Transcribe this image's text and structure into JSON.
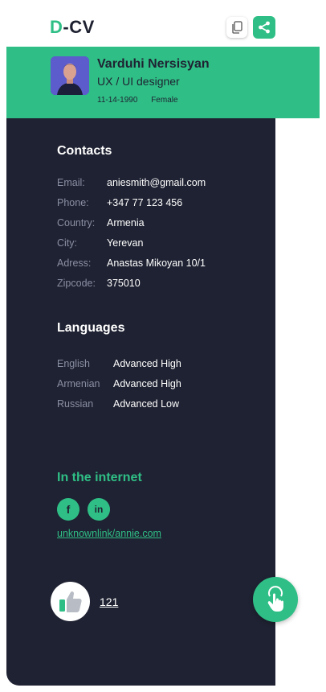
{
  "logo": {
    "prefix": "D",
    "rest": "-CV"
  },
  "toolbar": {
    "copy_icon": "copy-icon",
    "share_icon": "share-icon"
  },
  "profile": {
    "name": "Varduhi Nersisyan",
    "role": "UX / UI designer",
    "birthdate": "11-14-1990",
    "gender": "Female"
  },
  "contacts": {
    "title": "Contacts",
    "items": [
      {
        "label": "Email:",
        "value": "aniesmith@gmail.com"
      },
      {
        "label": "Phone:",
        "value": "+347 77 123 456"
      },
      {
        "label": "Country:",
        "value": "Armenia"
      },
      {
        "label": "City:",
        "value": "Yerevan"
      },
      {
        "label": "Adress:",
        "value": "Anastas Mikoyan 10/1"
      },
      {
        "label": "Zipcode:",
        "value": "375010"
      }
    ]
  },
  "languages": {
    "title": "Languages",
    "items": [
      {
        "language": "English",
        "level": "Advanced High"
      },
      {
        "language": "Armenian",
        "level": "Advanced High"
      },
      {
        "language": "Russian",
        "level": "Advanced Low"
      }
    ]
  },
  "internet": {
    "title": "In the internet",
    "facebook_glyph": "f",
    "linkedin_glyph": "in",
    "link": "unknownlink/annie.com"
  },
  "likes": {
    "count": "121"
  },
  "colors": {
    "accent": "#2fbf86",
    "dark": "#1f2232",
    "muted": "#8a8fa3"
  }
}
